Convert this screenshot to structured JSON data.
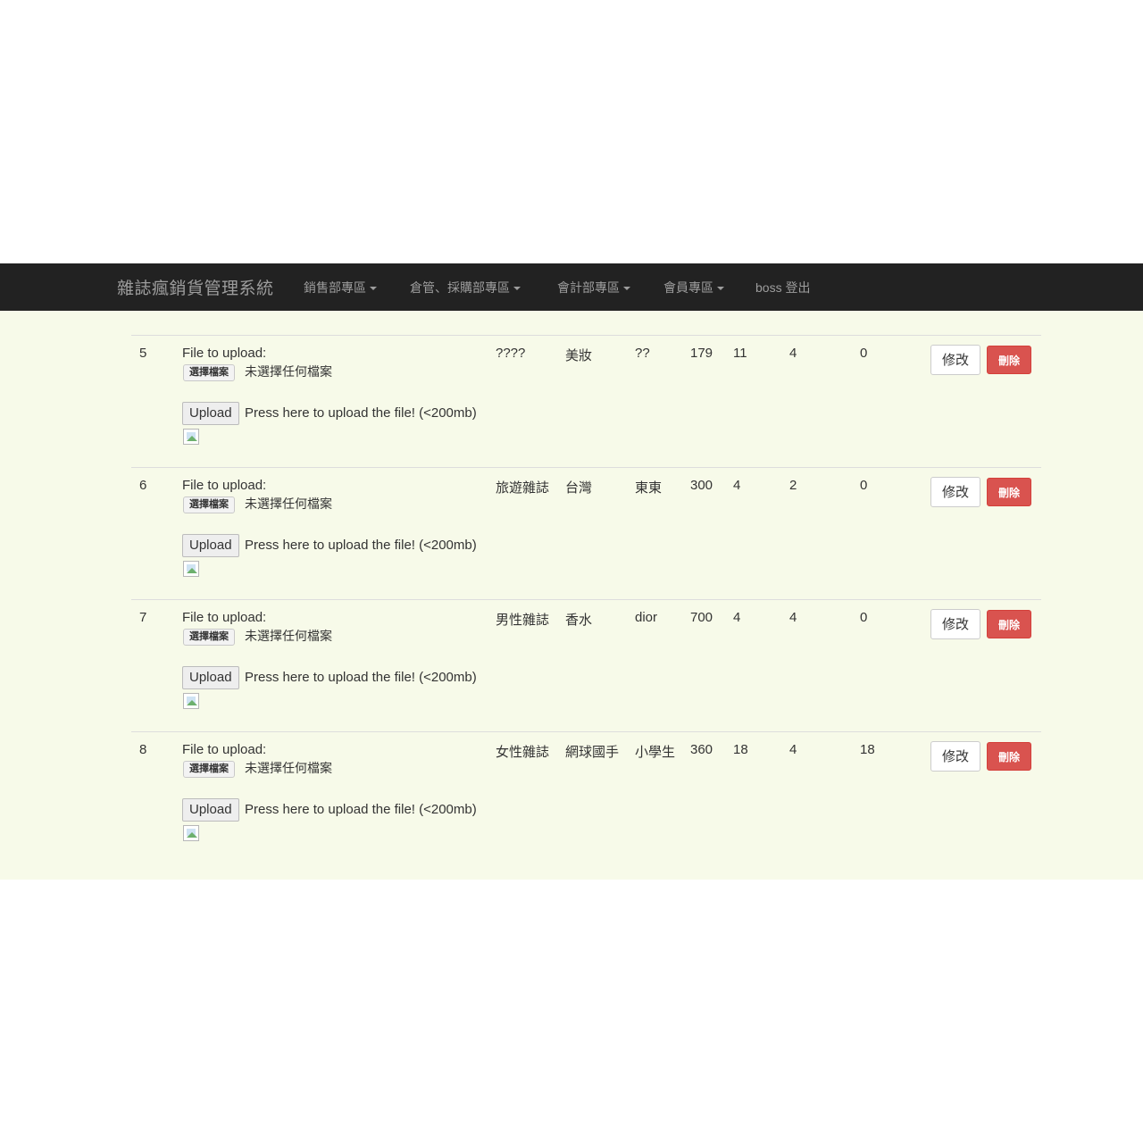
{
  "navbar": {
    "brand": "雜誌瘋銷貨管理系統",
    "items": [
      {
        "label": "銷售部專區",
        "dropdown": true
      },
      {
        "label": "倉管、採購部專區",
        "dropdown": true
      },
      {
        "label": "會計部專區",
        "dropdown": true
      },
      {
        "label": "會員專區",
        "dropdown": true
      },
      {
        "label": "boss 登出",
        "dropdown": false
      }
    ]
  },
  "upload": {
    "file_label": "File to upload:",
    "choose_label": "選擇檔案",
    "no_file_text": "未選擇任何檔案",
    "upload_label": "Upload",
    "hint": "Press here to upload the file! (<200mb)",
    "image_icon": "broken-image-icon"
  },
  "actions": {
    "edit_label": "修改",
    "delete_label": "刪除",
    "delete_color": "#d9534f"
  },
  "rows": [
    {
      "id": "5",
      "name": "????",
      "category": "美妝",
      "publisher": "??",
      "price": "179",
      "c5": "11",
      "c6": "4",
      "c7": "0"
    },
    {
      "id": "6",
      "name": "旅遊雜誌",
      "category": "台灣",
      "publisher": "東東",
      "price": "300",
      "c5": "4",
      "c6": "2",
      "c7": "0"
    },
    {
      "id": "7",
      "name": "男性雜誌",
      "category": "香水",
      "publisher": "dior",
      "price": "700",
      "c5": "4",
      "c6": "4",
      "c7": "0"
    },
    {
      "id": "8",
      "name": "女性雜誌",
      "category": "網球國手",
      "publisher": "小學生",
      "price": "360",
      "c5": "18",
      "c6": "4",
      "c7": "18"
    }
  ]
}
